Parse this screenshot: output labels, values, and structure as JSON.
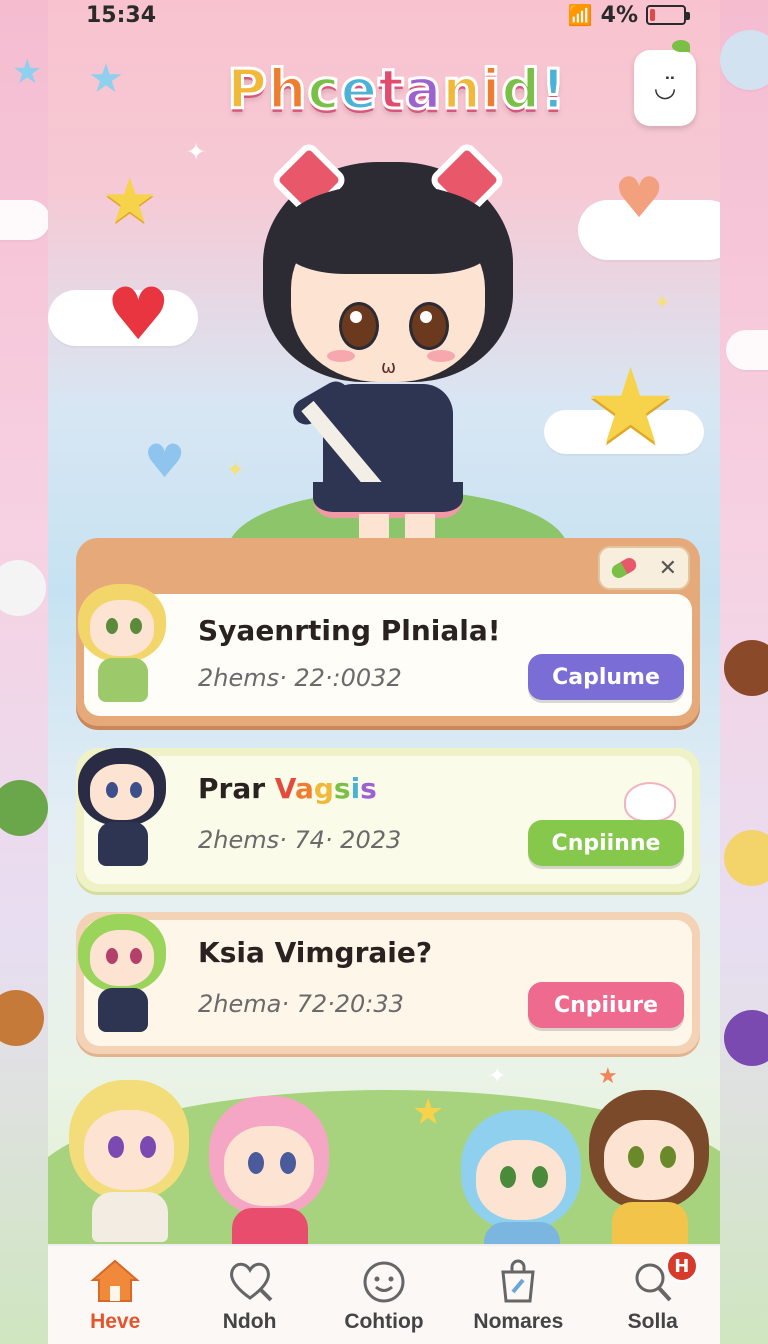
{
  "status_bar": {
    "time": "15:34",
    "battery": "4%",
    "battery_level": 0.04
  },
  "app": {
    "title": "Phcetanid!"
  },
  "notifications": [
    {
      "title": "Syaenrting Plniala!",
      "time": "2hems· 22·:0032",
      "button": "Caplume",
      "button_color": "#7a6ed6"
    },
    {
      "title_prefix": "Prar",
      "title_colored": "Vagsis",
      "time": "2hems· 74· 2023",
      "button": "Cnpiinne",
      "button_color": "#86c84c"
    },
    {
      "title": "Ksia Vimgraie?",
      "time": "2hema· 72·20:33",
      "button": "Cnpiiure",
      "button_color": "#ef6a8f"
    }
  ],
  "bottom_nav": {
    "items": [
      {
        "label": "Heve",
        "icon": "house-icon",
        "active": true
      },
      {
        "label": "Ndoh",
        "icon": "heart-search-icon",
        "active": false
      },
      {
        "label": "Cohtiop",
        "icon": "smiley-icon",
        "active": false
      },
      {
        "label": "Nomares",
        "icon": "bag-icon",
        "active": false
      },
      {
        "label": "Solla",
        "icon": "search-icon",
        "active": false,
        "badge": "H"
      }
    ]
  },
  "colors": {
    "accent": "#e5552c",
    "card1_frame": "#e6a97a",
    "card2_frame": "#eef2c6",
    "card3_frame": "#f4d2b5"
  }
}
